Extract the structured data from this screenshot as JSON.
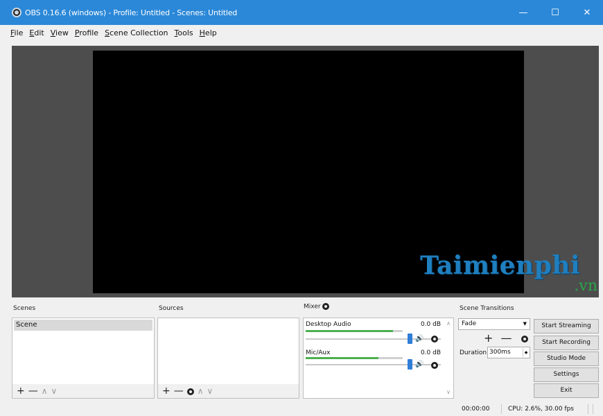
{
  "window": {
    "title": "OBS 0.16.6 (windows) - Profile: Untitled - Scenes: Untitled",
    "minimize": "—",
    "maximize": "☐",
    "close": "✕"
  },
  "menu": [
    {
      "accel": "F",
      "rest": "ile"
    },
    {
      "accel": "E",
      "rest": "dit"
    },
    {
      "accel": "V",
      "rest": "iew"
    },
    {
      "accel": "P",
      "rest": "rofile"
    },
    {
      "accel": "S",
      "rest": "cene Collection"
    },
    {
      "accel": "T",
      "rest": "ools"
    },
    {
      "accel": "H",
      "rest": "elp"
    }
  ],
  "watermark": {
    "main": "Taimienphi",
    "sub": ".vn"
  },
  "scenes": {
    "label": "Scenes",
    "items": [
      "Scene"
    ],
    "toolbar": {
      "add": "+",
      "remove": "—",
      "up": "∧",
      "down": "∨"
    }
  },
  "sources": {
    "label": "Sources",
    "toolbar": {
      "add": "+",
      "remove": "—",
      "up": "∧",
      "down": "∨"
    }
  },
  "mixer": {
    "label": "Mixer",
    "channels": [
      {
        "name": "Desktop Audio",
        "db": "0.0 dB",
        "level": 0.9,
        "volume": 1.0
      },
      {
        "name": "Mic/Aux",
        "db": "0.0 dB",
        "level": 0.75,
        "volume": 1.0
      }
    ]
  },
  "transitions": {
    "label": "Scene Transitions",
    "selected": "Fade",
    "duration_label": "Duration",
    "duration_value": "300ms",
    "add": "+",
    "remove": "—"
  },
  "controls": {
    "start_streaming": "Start Streaming",
    "start_recording": "Start Recording",
    "studio_mode": "Studio Mode",
    "settings": "Settings",
    "exit": "Exit"
  },
  "status": {
    "time": "00:00:00",
    "cpu": "CPU: 2.6%, 30.00 fps"
  },
  "colors": {
    "titlebar": "#2b88d8",
    "preview_bg": "#4d4d4d",
    "meter": "#4caf50",
    "slider_handle": "#2f7ed8"
  }
}
